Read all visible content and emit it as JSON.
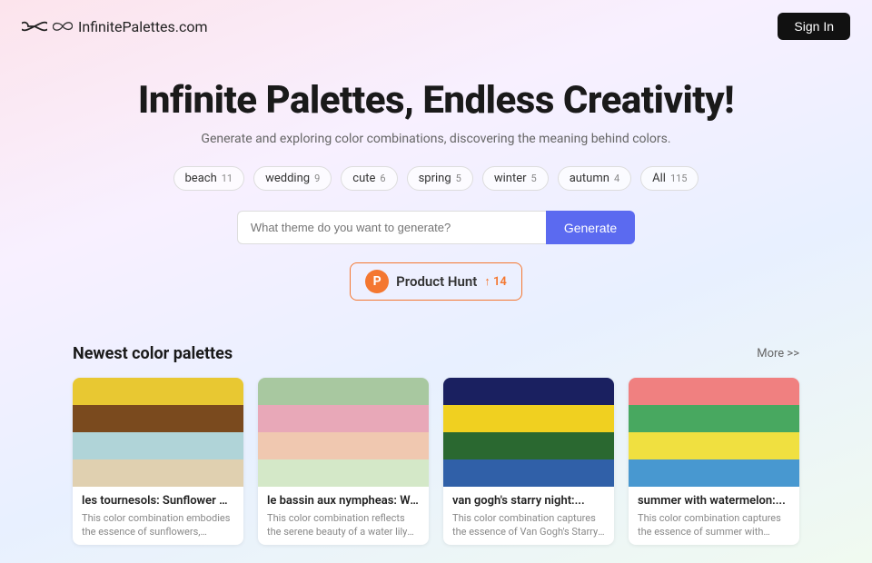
{
  "header": {
    "logo_icon_alt": "infinity-icon",
    "logo_text": "InfinitePalettes.com",
    "sign_in_label": "Sign In"
  },
  "hero": {
    "title": "Infinite Palettes, Endless Creativity!",
    "subtitle": "Generate and exploring color combinations, discovering the meaning behind colors.",
    "search_placeholder": "What theme do you want to generate?",
    "generate_label": "Generate"
  },
  "tags": [
    {
      "label": "beach",
      "count": "11"
    },
    {
      "label": "wedding",
      "count": "9"
    },
    {
      "label": "cute",
      "count": "6"
    },
    {
      "label": "spring",
      "count": "5"
    },
    {
      "label": "winter",
      "count": "5"
    },
    {
      "label": "autumn",
      "count": "4"
    },
    {
      "label": "All",
      "count": "115"
    }
  ],
  "product_hunt": {
    "icon_letter": "P",
    "badge_text": "Product Hunt",
    "upvote_number": "↑",
    "count": "14"
  },
  "palettes_section": {
    "title": "Newest color palettes",
    "more_label": "More >>"
  },
  "palettes": [
    {
      "name": "les tournesols: Sunflower Yello...",
      "desc": "This color combination embodies the essence of sunflowers, representing joy, stability, and a connection to nature. Th...",
      "swatches": [
        "#e8c832",
        "#7a4a1e",
        "#b0d4d8",
        "#e0d0b0"
      ]
    },
    {
      "name": "le bassin aux nympheas: Water...",
      "desc": "This color combination reflects the serene beauty of a water lily pond, combining the tranquility of nature with...",
      "swatches": [
        "#a8c8a0",
        "#e8a8b8",
        "#f0c8b0",
        "#d4e8c8"
      ]
    },
    {
      "name": "van gogh's starry night:...",
      "desc": "This color combination captures the essence of Van Gogh's Starry Night, blending the calmness of the night sky...",
      "swatches": [
        "#1a2060",
        "#f0d020",
        "#2a6830",
        "#3060a8"
      ]
    },
    {
      "name": "summer with watermelon:...",
      "desc": "This color combination captures the essence of summer with watermelon, blending vibrant and refreshing hues th...",
      "swatches": [
        "#f08080",
        "#48a860",
        "#f0e040",
        "#4898d0"
      ]
    }
  ]
}
